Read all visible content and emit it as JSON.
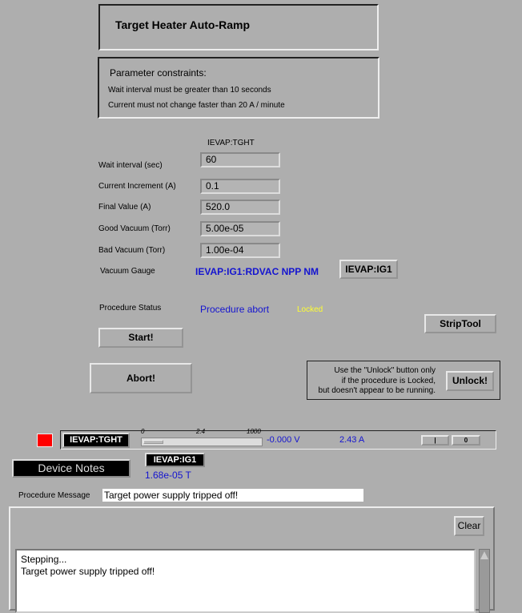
{
  "title": "Target Heater Auto-Ramp",
  "constraints": {
    "heading": "Parameter constraints:",
    "line1": "Wait interval must be greater than 10 seconds",
    "line2": "Current must not change faster than 20 A / minute"
  },
  "device": "IEVAP:TGHT",
  "params": [
    {
      "label": "Wait interval (sec)",
      "value": "60"
    },
    {
      "label": "Current Increment (A)",
      "value": "0.1"
    },
    {
      "label": "Final Value (A)",
      "value": "520.0"
    },
    {
      "label": "Good Vacuum (Torr)",
      "value": "5.00e-05"
    },
    {
      "label": "Bad Vacuum (Torr)",
      "value": "1.00e-04"
    }
  ],
  "vacuum_gauge": {
    "label": "Vacuum Gauge",
    "value": "IEVAP:IG1:RDVAC NPP NM",
    "button": "IEVAP:IG1"
  },
  "status": {
    "label": "Procedure Status",
    "value": "Procedure abort",
    "lock": "Locked"
  },
  "buttons": {
    "start": "Start!",
    "abort": "Abort!",
    "striptool": "StripTool",
    "unlock": "Unlock!",
    "clear": "Clear"
  },
  "unlock_note": {
    "l1": "Use the \"Unlock\" button only",
    "l2": "if the procedure is Locked,",
    "l3": "but doesn't appear to be running."
  },
  "supply": {
    "name": "IEVAP:TGHT",
    "scale_min": "0",
    "scale_mid": "2.4",
    "scale_max": "1000",
    "voltage": "-0.000 V",
    "current": "2.43 A",
    "btn_on": "|",
    "btn_off": "0",
    "indicator_color": "#ff0000"
  },
  "device_notes": "Device Notes",
  "gauge": {
    "name": "IEVAP:IG1",
    "value": "1.68e-05 T"
  },
  "message": {
    "label": "Procedure Message",
    "value": "Target power supply tripped off!"
  },
  "log": [
    "Stepping...",
    "Target power supply tripped off!"
  ]
}
